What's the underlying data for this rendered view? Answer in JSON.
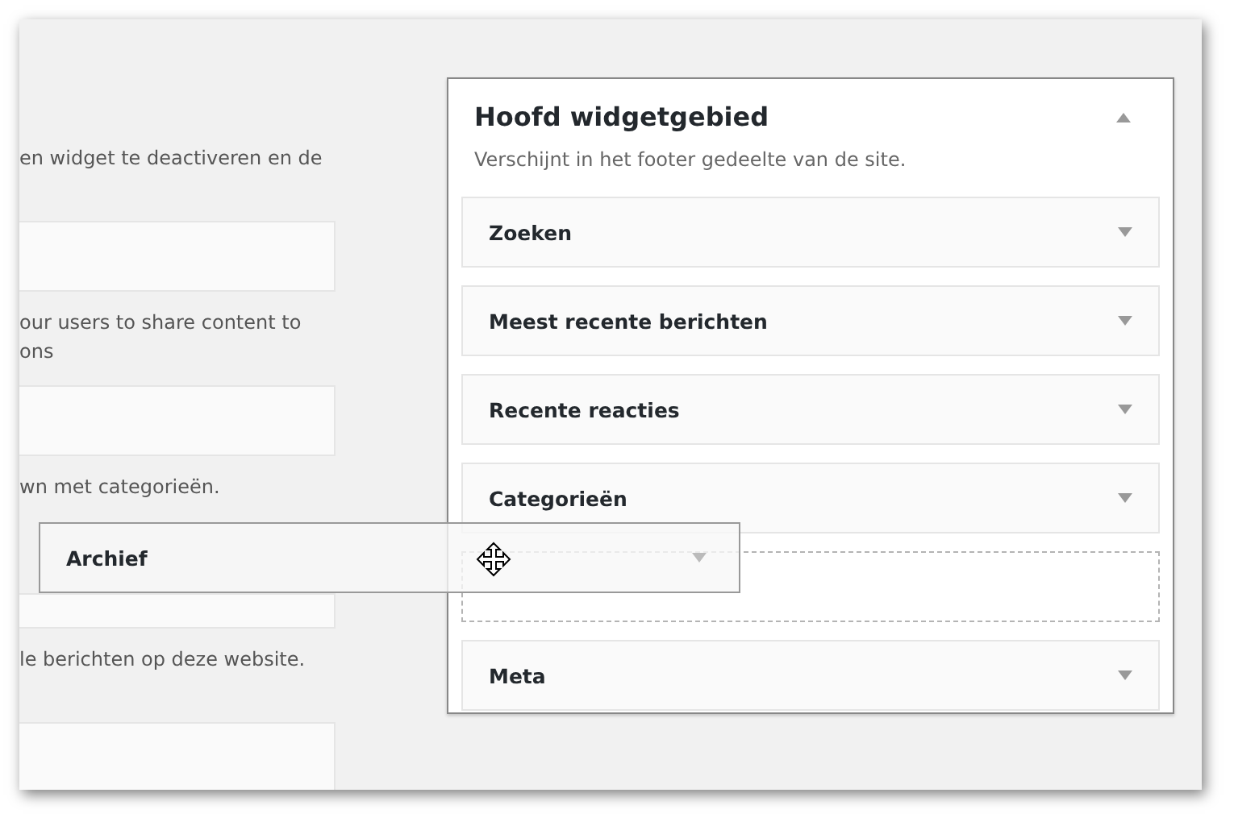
{
  "available_widgets": [
    {
      "description_lines": [
        "en widget te deactiveren en de"
      ]
    },
    {
      "description_lines": [
        "our users to share content to",
        "ons"
      ]
    },
    {
      "description_lines": [
        "wn met categorieën."
      ],
      "covered": true
    },
    {
      "description_lines": [
        "le berichten op deze website."
      ]
    }
  ],
  "sidebar_area": {
    "title": "Hoofd widgetgebied",
    "description": "Verschijnt in het footer gedeelte van de site.",
    "widgets": [
      {
        "kind": "widget",
        "title": "Zoeken"
      },
      {
        "kind": "widget",
        "title": "Meest recente berichten"
      },
      {
        "kind": "widget",
        "title": "Recente reacties"
      },
      {
        "kind": "widget",
        "title": "Categorieën"
      },
      {
        "kind": "placeholder"
      },
      {
        "kind": "widget",
        "title": "Meta"
      }
    ]
  },
  "dragged_widget": {
    "title": "Archief"
  }
}
